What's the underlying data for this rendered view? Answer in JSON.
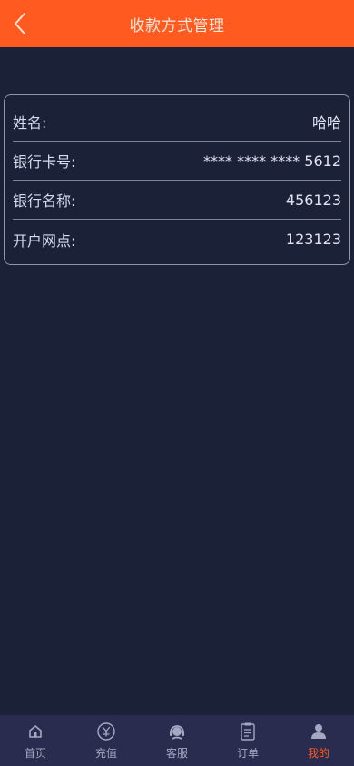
{
  "header": {
    "title": "收款方式管理"
  },
  "bank_info": {
    "rows": [
      {
        "label": "姓名:",
        "value": "哈哈"
      },
      {
        "label": "银行卡号:",
        "value": "**** **** **** 5612"
      },
      {
        "label": "银行名称:",
        "value": "456123"
      },
      {
        "label": "开户网点:",
        "value": "123123"
      }
    ]
  },
  "tabbar": {
    "items": [
      {
        "label": "首页",
        "icon": "home-icon"
      },
      {
        "label": "充值",
        "icon": "yen-icon"
      },
      {
        "label": "客服",
        "icon": "customer-service-icon"
      },
      {
        "label": "订单",
        "icon": "order-icon"
      },
      {
        "label": "我的",
        "icon": "user-icon",
        "active": true
      }
    ]
  },
  "colors": {
    "accent": "#ff5a1f",
    "background": "#1b2137",
    "tabbar_bg": "#292c4e"
  }
}
